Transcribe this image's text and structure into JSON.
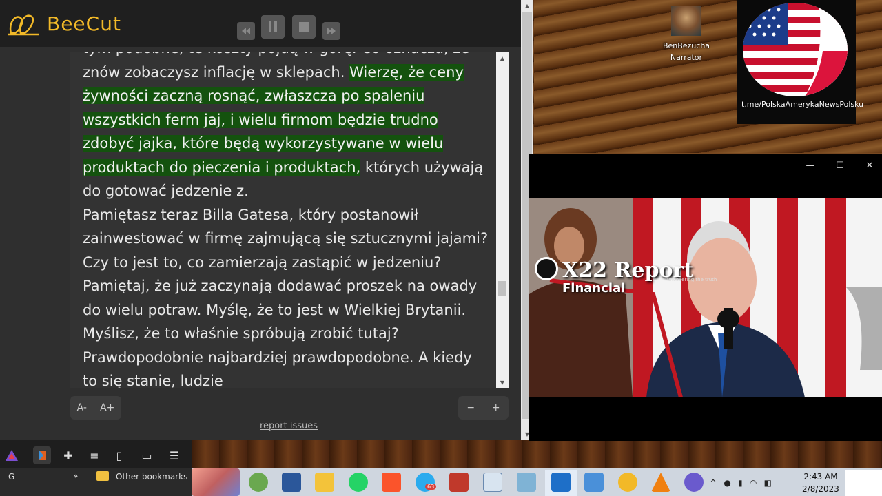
{
  "app": {
    "name": "BeeCut"
  },
  "reader": {
    "paragraph1_part1": "tym podobne, te koszty pójdą w górę. Co oznacza, że znów zobaczysz inflację w sklepach. ",
    "paragraph1_highlight": "Wierzę, że ceny żywności zaczną rosnąć, zwłaszcza po spaleniu wszystkich ferm jaj, i wielu firmom będzie trudno zdobyć jajka, które będą wykorzystywane w wielu produktach do pieczenia i produktach,",
    "paragraph1_part2": " których używają do gotować jedzenie z.",
    "paragraph2": "Pamiętasz teraz Billa Gatesa, który postanowił zainwestować w firmę zajmującą się sztucznymi jajami? Czy to jest to, co zamierzają zastąpić w jedzeniu? Pamiętaj, że już zaczynają dodawać proszek na owady do wielu potraw. Myślę, że to jest w Wielkiej Brytanii. Myślisz, że to właśnie spróbują zrobić tutaj? Prawdopodobnie najbardziej prawdopodobne. A kiedy to się stanie, ludzie",
    "font_decrease": "A-",
    "font_increase": "A+",
    "zoom_out": "−",
    "zoom_in": "+",
    "report_link": "report issues"
  },
  "desktop": {
    "icon1_label": "BenBezucha Narrator",
    "tile_caption": "t.me/PolskaAmerykaNewsPolsku"
  },
  "video": {
    "title_main": "X22 Report",
    "title_sub": "Financial",
    "tagline": "uncovering the truth",
    "minimize": "—",
    "maximize": "☐",
    "close": "✕"
  },
  "browser_bar": {
    "tab_letter": "G",
    "overflow": "»",
    "bookmarks_folder": "Other bookmarks"
  },
  "taskbar": {
    "time": "2:43 AM",
    "date": "2/8/2023",
    "telegram_badge": "63"
  },
  "colors": {
    "highlight": "#14520e",
    "brand": "#f2b928"
  }
}
